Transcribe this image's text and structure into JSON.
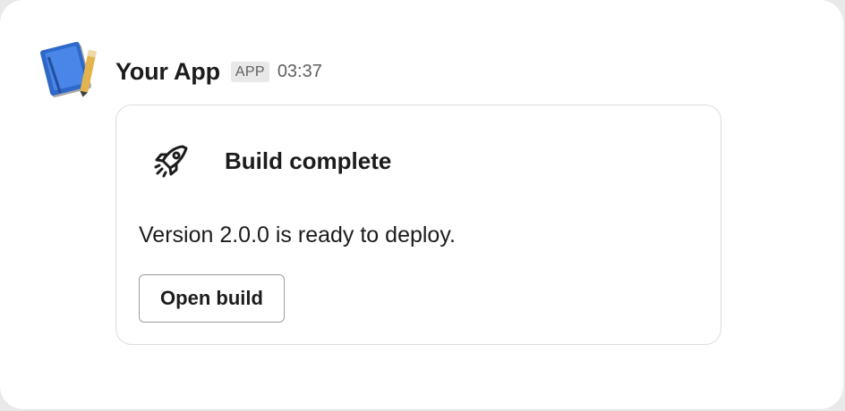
{
  "app": {
    "name": "Your App",
    "badge": "APP",
    "time": "03:37",
    "avatar_icon": "notebook-pencil-icon"
  },
  "card": {
    "icon": "rocket-icon",
    "title": "Build complete",
    "text": "Version 2.0.0 is ready to deploy.",
    "button_label": "Open build"
  },
  "colors": {
    "text": "#1d1c1d",
    "muted": "#616061",
    "badge_bg": "#e8e8e8",
    "border": "#dddddd",
    "notebook_blue": "#3f78d6",
    "pencil_yellow": "#e7b64b"
  }
}
